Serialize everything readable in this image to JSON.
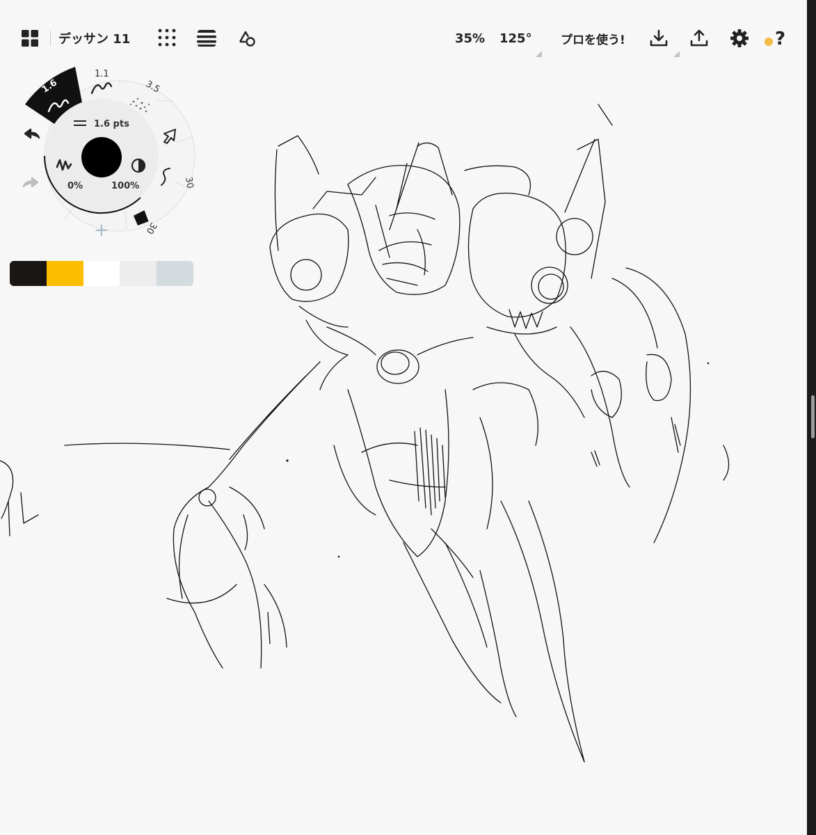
{
  "topbar": {
    "document_title": "デッサン 11",
    "zoom": "35%",
    "rotation": "125°",
    "pro_label": "プロを使う!",
    "help_label": "?",
    "icons": {
      "gallery": "gallery-grid-icon",
      "grid": "dot-grid-icon",
      "layers": "layers-icon",
      "shapes": "shapes-icon",
      "export": "download-icon",
      "share": "upload-icon",
      "settings": "gear-icon",
      "help": "help-icon"
    },
    "colors": {
      "help_dot": "#f3bb45"
    }
  },
  "tool_wheel": {
    "active_brush_size": "1.6",
    "brush_2_size": "1.1",
    "brush_3_size": "3.5",
    "stroke_size": "1.6 pts",
    "smoothing": "0%",
    "opacity": "100%",
    "smoothing_ring_value": "30",
    "fill_ring_value": "30",
    "add_label": "+",
    "colors": {
      "active_segment": "#111111",
      "current_color": "#000000"
    }
  },
  "palette": {
    "swatches": [
      "#1a1613",
      "#fbbd00",
      "#ffffff",
      "#ededed",
      "#d4dbde"
    ]
  }
}
